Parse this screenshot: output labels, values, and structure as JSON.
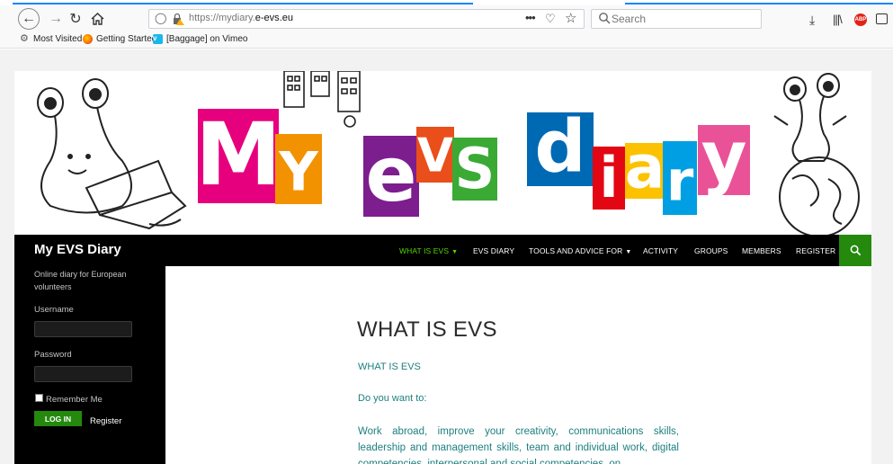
{
  "browser": {
    "url_prefix": "https://mydiary.",
    "url_domain": "e-evs.eu",
    "search_placeholder": "Search",
    "bookmarks": [
      {
        "label": "Most Visited",
        "icon": "gear-icon"
      },
      {
        "label": "Getting Started",
        "icon": "firefox-icon"
      },
      {
        "label": "[Baggage] on Vimeo",
        "icon": "vimeo-icon"
      }
    ],
    "abp_label": "ABP",
    "accent_color": "#0a84ff"
  },
  "banner": {
    "letters": [
      {
        "char": "M",
        "bg": "#e6007e",
        "fg": "#ffffff"
      },
      {
        "char": "Y",
        "bg": "#f39200",
        "fg": "#ffffff"
      },
      {
        "char": "e",
        "bg": "#7d1e8e",
        "fg": "#ffffff"
      },
      {
        "char": "V",
        "bg": "#e94e1b",
        "fg": "#ffffff"
      },
      {
        "char": "S",
        "bg": "#3aaa35",
        "fg": "#ffffff"
      },
      {
        "char": "d",
        "bg": "#0069b4",
        "fg": "#ffffff"
      },
      {
        "char": "i",
        "bg": "#e30613",
        "fg": "#ffffff"
      },
      {
        "char": "a",
        "bg": "#fcc200",
        "fg": "#ffffff"
      },
      {
        "char": "r",
        "bg": "#009fe3",
        "fg": "#ffffff"
      },
      {
        "char": "y",
        "bg": "#ea5297",
        "fg": "#ffffff"
      }
    ]
  },
  "site": {
    "title": "My EVS Diary",
    "description": "Online diary for European volunteers",
    "menu": [
      {
        "label": "WHAT IS EVS",
        "active": true,
        "dropdown": true
      },
      {
        "label": "EVS DIARY",
        "active": false,
        "dropdown": false
      },
      {
        "label": "TOOLS AND ADVICE FOR",
        "active": false,
        "dropdown": true
      },
      {
        "label": "ACTIVITY",
        "active": false,
        "dropdown": false
      },
      {
        "label": "GROUPS",
        "active": false,
        "dropdown": false
      },
      {
        "label": "MEMBERS",
        "active": false,
        "dropdown": false
      },
      {
        "label": "REGISTER",
        "active": false,
        "dropdown": false
      }
    ],
    "colors": {
      "nav_bg": "#000000",
      "active": "#55d400",
      "button_green": "#24890d",
      "text_teal": "#1d7f7f"
    }
  },
  "login": {
    "username_label": "Username",
    "password_label": "Password",
    "remember_label": "Remember Me",
    "login_button": "LOG IN",
    "register_link": "Register"
  },
  "content": {
    "title": "WHAT IS EVS",
    "subtitle": "WHAT IS EVS",
    "question": "Do you want to:",
    "body": "Work abroad, improve your creativity, communications skills, leadership and management skills, team and individual work, digital competencies, interpersonal and social competencies, on"
  }
}
